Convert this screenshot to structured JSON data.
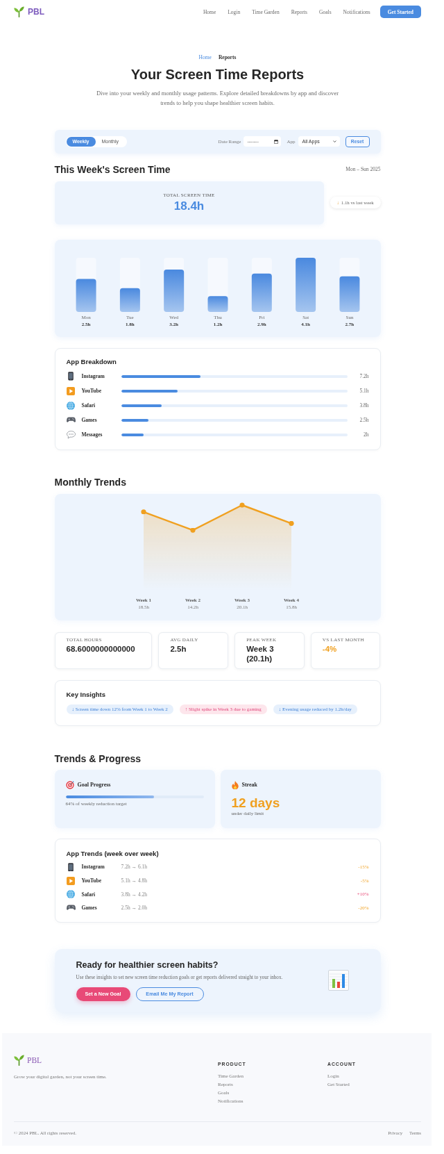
{
  "nav": {
    "logo": "PBL",
    "links": [
      "Home",
      "Login",
      "Time Garden",
      "Reports",
      "Goals",
      "Notifications"
    ],
    "button": "Get Started"
  },
  "breadcrumb": [
    {
      "label": "Home",
      "current": false
    },
    {
      "label": "Reports",
      "current": true
    }
  ],
  "hero": {
    "title": "Your Screen Time Reports",
    "subtitle": "Dive into your weekly and monthly usage patterns. Explore detailed breakdowns by app and discover trends to help you shape healthier screen habits."
  },
  "filters": {
    "periods": [
      {
        "label": "Weekly",
        "selected": true
      },
      {
        "label": "Monthly",
        "selected": false
      }
    ],
    "date_label": "Date Range",
    "date_field": {
      "placeholder": "-------"
    },
    "app_label": "App",
    "app_select": {
      "value": "All Apps"
    },
    "reset_button": "Reset"
  },
  "week": {
    "title": "This Week's Screen Time",
    "range": "Mon – Sun 2025",
    "total": {
      "label": "TOTAL SCREEN TIME",
      "value": "18.4h"
    },
    "comparison": {
      "arrow": "↓",
      "text": "1.1h vs last week"
    },
    "chart_data": {
      "type": "bar",
      "categories": [
        "Mon",
        "Tue",
        "Wed",
        "Thu",
        "Fri",
        "Sat",
        "Sun"
      ],
      "values": [
        2.5,
        1.8,
        3.2,
        1.2,
        2.9,
        4.1,
        2.7
      ],
      "value_labels": [
        "2.5h",
        "1.8h",
        "3.2h",
        "1.2h",
        "2.9h",
        "4.1h",
        "2.7h"
      ]
    }
  },
  "app_breakdown": {
    "title": "App Breakdown",
    "apps": [
      {
        "name": "Instagram",
        "level": 0.35,
        "time": "7.2h"
      },
      {
        "name": "YouTube",
        "level": 0.25,
        "time": "5.1h"
      },
      {
        "name": "Safari",
        "level": 0.18,
        "time": "3.8h"
      },
      {
        "name": "Games",
        "level": 0.12,
        "time": "2.5h"
      },
      {
        "name": "Messages",
        "level": 0.1,
        "time": "2h"
      }
    ]
  },
  "monthly": {
    "title": "Monthly Trends",
    "chart_data": {
      "type": "area",
      "categories": [
        "Week 1",
        "Week 2",
        "Week 3",
        "Week 4"
      ],
      "values": [
        18.5,
        14.2,
        20.1,
        15.8
      ],
      "value_labels": [
        "18.5h",
        "14.2h",
        "20.1h",
        "15.8h"
      ]
    },
    "stats": [
      {
        "label": "TOTAL HOURS",
        "value": "68.6000000000000",
        "accent": false
      },
      {
        "label": "AVG DAILY",
        "value": "2.5h",
        "accent": false
      },
      {
        "label": "PEAK WEEK",
        "value": "Week 3 (20.1h)",
        "accent": false
      },
      {
        "label": "VS LAST MONTH",
        "value": "-4%",
        "accent": true
      }
    ]
  },
  "insights": {
    "title": "Key Insights",
    "items": [
      {
        "text": "↓ Screen time down 12% from Week 1 to Week 2",
        "kind": "positive"
      },
      {
        "text": "↑ Slight spike in Week 3 due to gaming",
        "kind": "warning"
      },
      {
        "text": "↓ Evening usage reduced by 1.2h/day",
        "kind": "positive"
      }
    ]
  },
  "progress": {
    "title": "Trends & Progress",
    "goal": {
      "title": "Goal Progress",
      "level": 0.64,
      "caption": "64% of weekly reduction target"
    },
    "streak": {
      "title": "Streak",
      "value": "12 days",
      "caption": "under daily limit"
    }
  },
  "app_trends": {
    "title": "App Trends (week over week)",
    "rows": [
      {
        "name": "Instagram",
        "change": "7.2h → 6.1h",
        "delta": "-15%",
        "kind": "down"
      },
      {
        "name": "YouTube",
        "change": "5.1h → 4.8h",
        "delta": "-5%",
        "kind": "down"
      },
      {
        "name": "Safari",
        "change": "3.8h → 4.2h",
        "delta": "+10%",
        "kind": "up"
      },
      {
        "name": "Games",
        "change": "2.5h → 2.0h",
        "delta": "-20%",
        "kind": "down"
      }
    ]
  },
  "cta": {
    "title": "Ready for healthier screen habits?",
    "text": "Use these insights to set new screen time reduction goals or get reports delivered straight to your inbox.",
    "buttons": [
      {
        "label": "Set a New Goal",
        "kind": "primary"
      },
      {
        "label": "Email Me My Report",
        "kind": "outline"
      }
    ]
  },
  "footer": {
    "logo": "PBL",
    "tagline": "Grow your digital garden, not your screen time.",
    "columns": [
      {
        "title": "PRODUCT",
        "links": [
          "Time Garden",
          "Reports",
          "Goals",
          "Notifications"
        ]
      },
      {
        "title": "ACCOUNT",
        "links": [
          "Login",
          "Get Started"
        ]
      }
    ],
    "copyright": "© 2024 PBL. All rights reserved.",
    "legal": [
      "Privacy",
      "Terms"
    ]
  }
}
